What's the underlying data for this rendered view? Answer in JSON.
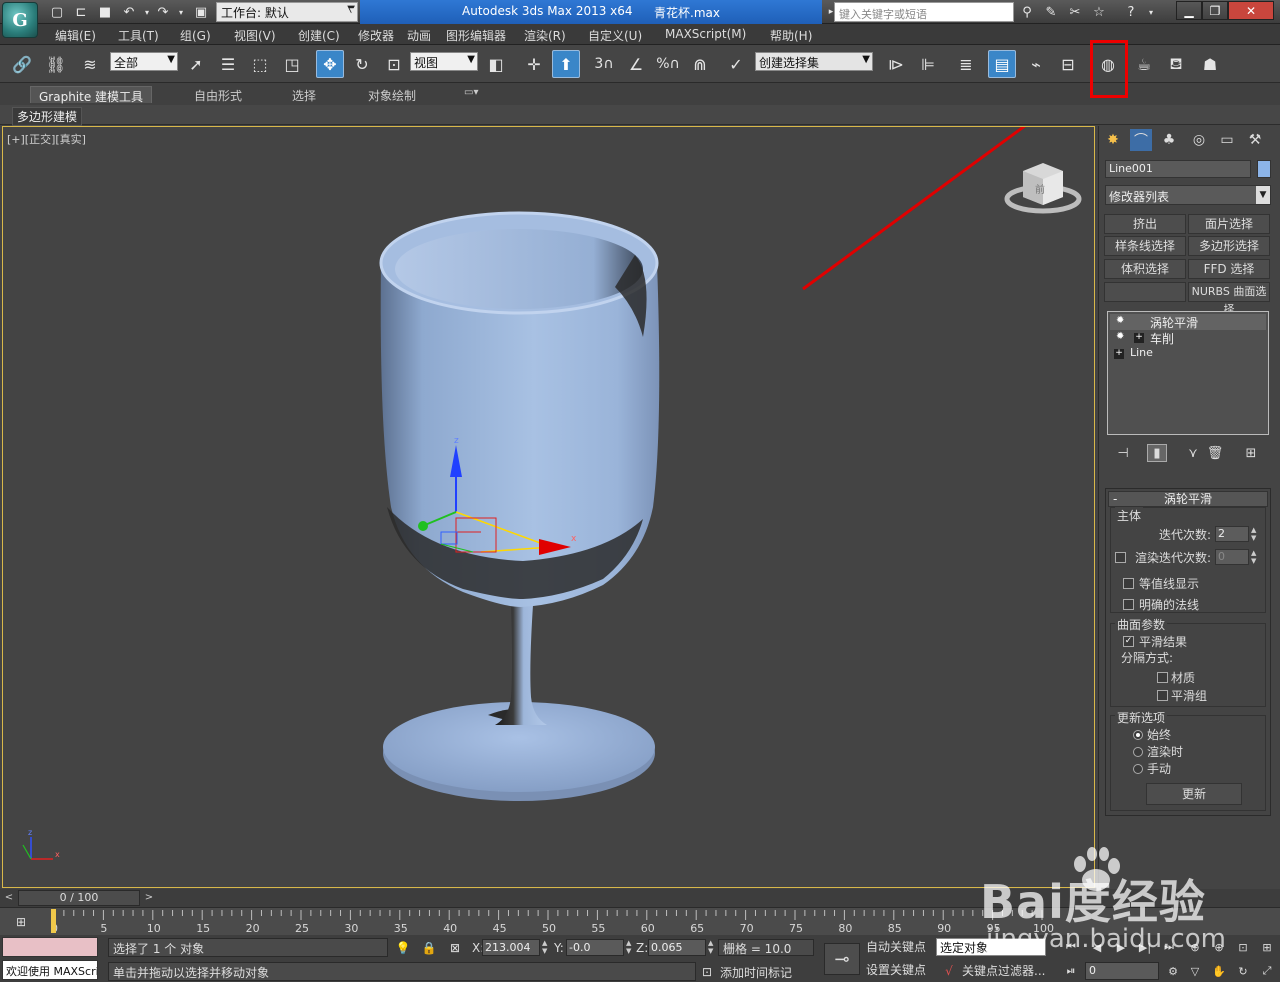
{
  "titlebar": {
    "workspace_label": "工作台: 默认",
    "app_title": "Autodesk 3ds Max  2013 x64",
    "file_name": "青花杯.max",
    "search_placeholder": "键入关键字或短语",
    "logo_letter": "G"
  },
  "menu": [
    {
      "label": "编辑(E)"
    },
    {
      "label": "工具(T)"
    },
    {
      "label": "组(G)"
    },
    {
      "label": "视图(V)"
    },
    {
      "label": "创建(C)"
    },
    {
      "label": "修改器"
    },
    {
      "label": "动画"
    },
    {
      "label": "图形编辑器"
    },
    {
      "label": "渲染(R)"
    },
    {
      "label": "自定义(U)"
    },
    {
      "label": "MAXScript(M)"
    },
    {
      "label": "帮助(H)"
    }
  ],
  "toolbar": {
    "selection_filter": "全部",
    "reference_coord": "视图",
    "named_selection": "创建选择集",
    "snap_3": "3",
    "angle_snap_percent": "%"
  },
  "ribbon": {
    "tabs": [
      {
        "label": "Graphite 建模工具"
      },
      {
        "label": "自由形式"
      },
      {
        "label": "选择"
      },
      {
        "label": "对象绘制"
      }
    ],
    "sub_label": "多边形建模"
  },
  "viewport": {
    "label": "[+][正交][真实]",
    "viewcube_label": "前",
    "gizmo": {
      "x": "x",
      "z": "z"
    },
    "axis_tripod": {
      "x": "x",
      "z": "z"
    },
    "object_color": "#8fb0e0"
  },
  "command_panel": {
    "object_name": "Line001",
    "modifier_list": "修改器列表",
    "mod_buttons": [
      {
        "label": "挤出"
      },
      {
        "label": "面片选择"
      },
      {
        "label": "样条线选择"
      },
      {
        "label": "多边形选择"
      },
      {
        "label": "体积选择"
      },
      {
        "label": "FFD 选择"
      },
      {
        "label": ""
      },
      {
        "label": "NURBS 曲面选择"
      }
    ],
    "stack": [
      {
        "label": "涡轮平滑"
      },
      {
        "label": "车削"
      },
      {
        "label": "Line"
      }
    ],
    "rollout": {
      "title": "涡轮平滑",
      "main_group": "主体",
      "iterations_label": "迭代次数:",
      "iterations_value": "2",
      "render_iters_label": "渲染迭代次数:",
      "render_iters_value": "0",
      "isoline_label": "等值线显示",
      "explicit_normals_label": "明确的法线",
      "surface_group": "曲面参数",
      "smooth_result_label": "平滑结果",
      "separate_by_label": "分隔方式:",
      "materials_label": "材质",
      "smoothing_groups_label": "平滑组",
      "update_group": "更新选项",
      "always_label": "始终",
      "when_rendering_label": "渲染时",
      "manually_label": "手动",
      "update_button": "更新"
    }
  },
  "timeline": {
    "frame_readout": "0 / 100",
    "ticks": [
      "0",
      "5",
      "10",
      "15",
      "20",
      "25",
      "30",
      "35",
      "40",
      "45",
      "50",
      "55",
      "60",
      "65",
      "70",
      "75",
      "80",
      "85",
      "90",
      "95",
      "100"
    ],
    "frame_max": 100
  },
  "status": {
    "maxscript_text": "欢迎使用 MAXScri",
    "selected_msg": "选择了 1 个 对象",
    "prompt_msg": "单击并拖动以选择并移动对象",
    "x_label": "X:",
    "x_value": "213.004",
    "y_label": "Y:",
    "y_value": "-0.0",
    "z_label": "Z:",
    "z_value": "0.065",
    "grid": "栅格 = 10.0",
    "add_time_tag": "添加时间标记",
    "auto_key": "自动关键点",
    "set_key": "设置关键点",
    "selected_object": "选定对象",
    "key_filters": "关键点过滤器...",
    "current_frame": "0"
  },
  "watermark": {
    "brand": "Bai度经验",
    "url": "jingyan.baidu.com"
  },
  "colors": {
    "title_blue": "#2f78d4",
    "highlight_red": "#e00000",
    "viewport_border": "#d8b84a"
  }
}
